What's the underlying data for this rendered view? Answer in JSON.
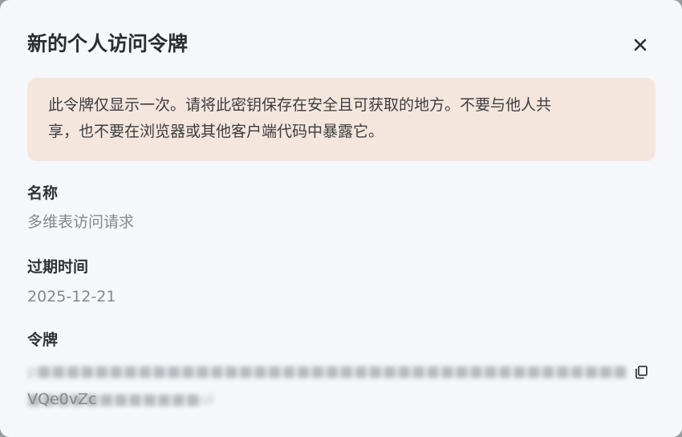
{
  "dialog": {
    "title": "新的个人访问令牌",
    "close_icon": "close-icon"
  },
  "warning": {
    "line1": "此令牌仅显示一次。请将此密钥保存在安全且可获取的地方。不要与他人共",
    "line2": "享，也不要在浏览器或其他客户端代码中暴露它。"
  },
  "fields": {
    "name_label": "名称",
    "name_value": "多维表访问请求",
    "expiry_label": "过期时间",
    "expiry_value": "2025-12-21",
    "token_label": "令牌",
    "token_line2": "VQe0vZc",
    "copy_icon": "copy-icon"
  },
  "colors": {
    "dialog_bg": "#f6f7fb",
    "warning_bg": "#f4e6dd",
    "label_text": "#2f3136",
    "value_text": "#85878d"
  }
}
